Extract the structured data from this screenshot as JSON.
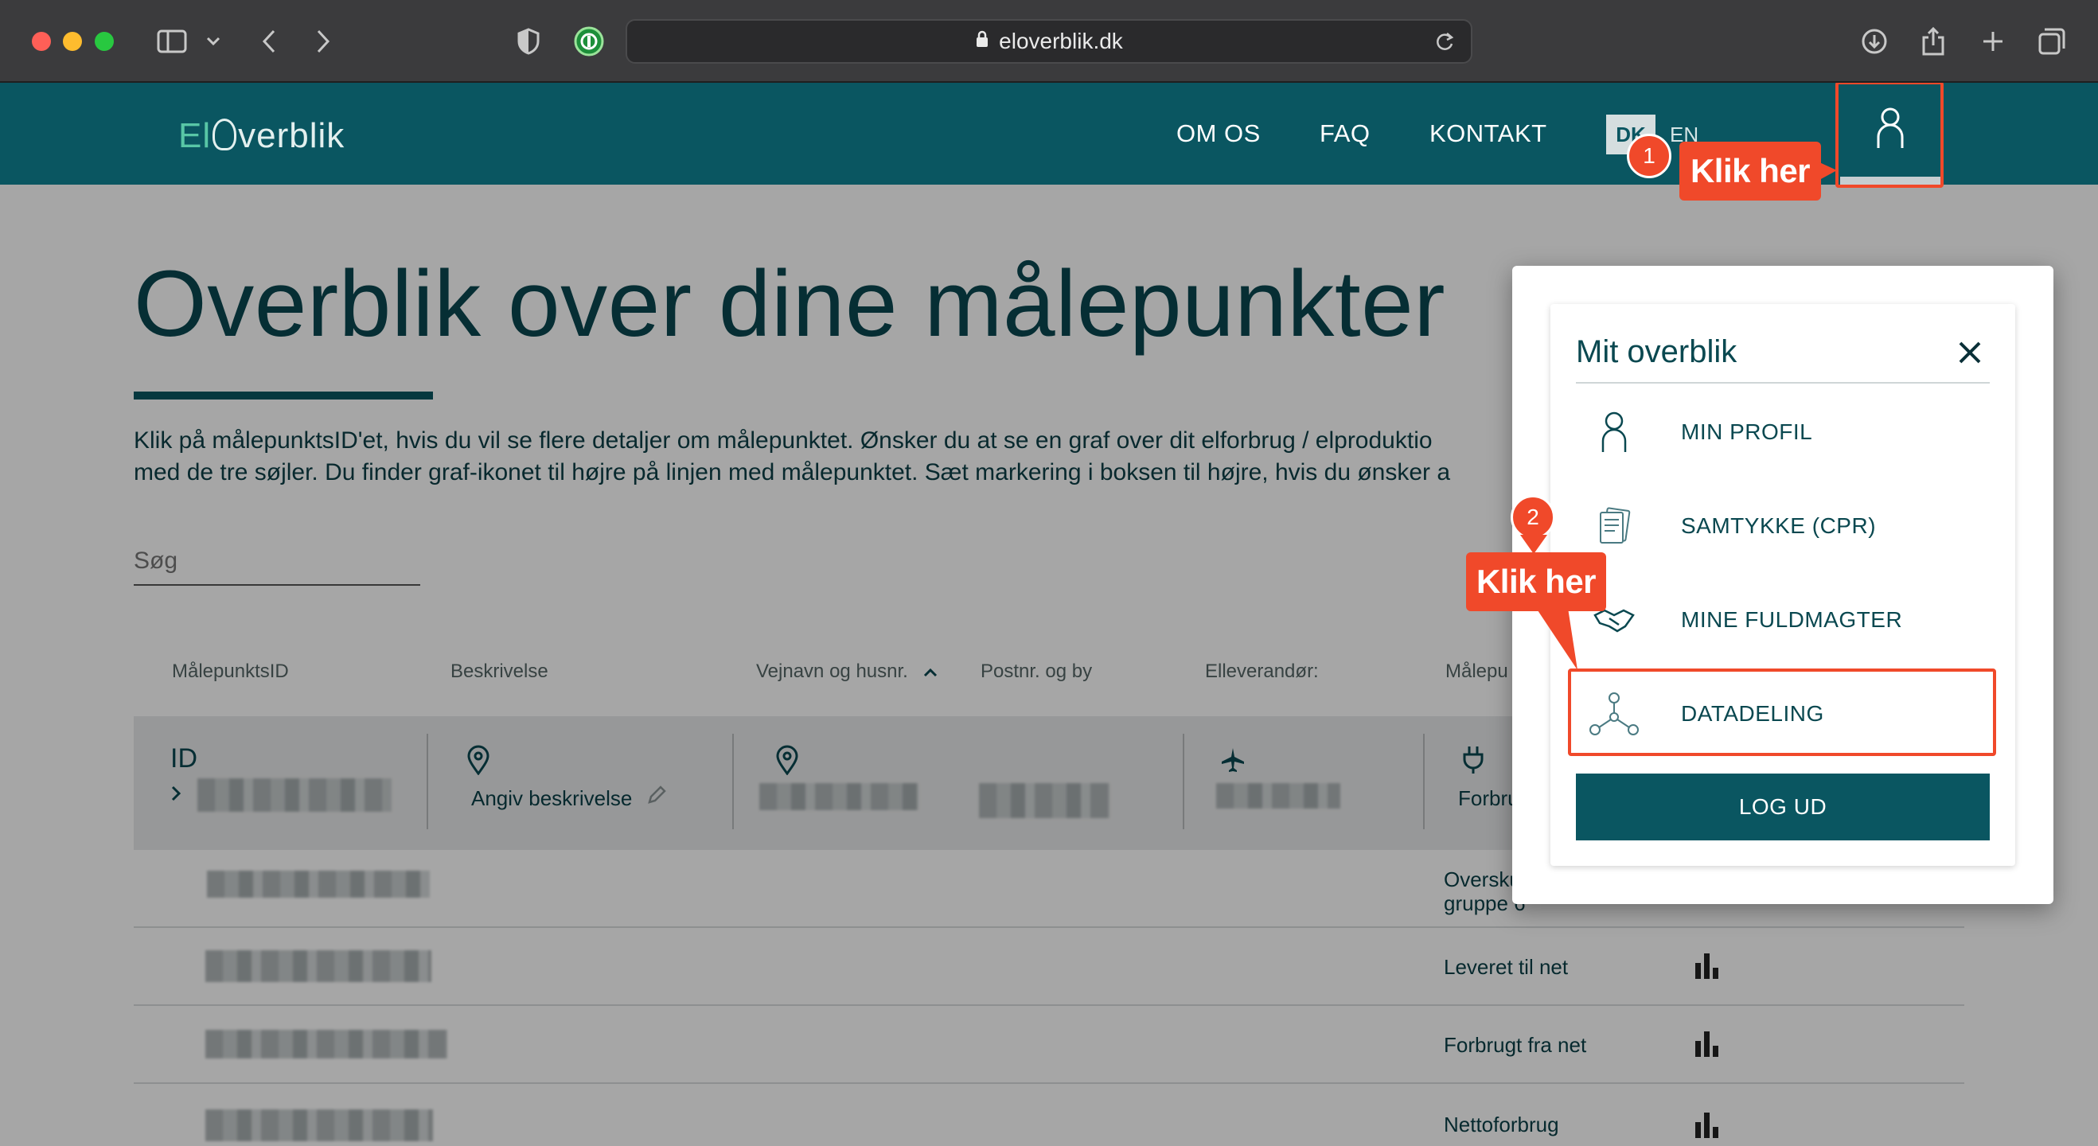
{
  "browser": {
    "url": "eloverblik.dk"
  },
  "header": {
    "logo_el": "El",
    "logo_rest": "verblik",
    "nav": [
      "OM OS",
      "FAQ",
      "KONTAKT"
    ],
    "lang_active": "DK",
    "lang_other": "EN"
  },
  "main": {
    "title": "Overblik over dine målepunkter",
    "intro_line1": "Klik på målepunktsID'et, hvis du vil se flere detaljer om målepunktet. Ønsker du at se en graf over dit elforbrug / elproduktio",
    "intro_line2": "med de tre søjler. Du finder graf-ikonet til højre på linjen med målepunktet. Sæt markering i boksen til højre, hvis du ønsker a",
    "search_placeholder": "Søg",
    "columns": [
      "MålepunktsID",
      "Beskrivelse",
      "Vejnavn og husnr.",
      "Postnr. og by",
      "Elleverandør:",
      "Målepu"
    ],
    "main_row": {
      "id_label": "ID",
      "description": "Angiv beskrivelse",
      "type_partial": "Forbru"
    },
    "rows": [
      {
        "label": "Oversku\ngruppe 6"
      },
      {
        "label": "Leveret til net"
      },
      {
        "label": "Forbrugt fra net"
      },
      {
        "label": "Nettoforbrug"
      }
    ]
  },
  "panel": {
    "title": "Mit overblik",
    "items": [
      {
        "label": "MIN PROFIL",
        "icon": "person-icon"
      },
      {
        "label": "SAMTYKKE (CPR)",
        "icon": "documents-icon"
      },
      {
        "label": "MINE FULDMAGTER",
        "icon": "handshake-icon"
      },
      {
        "label": "DATADELING",
        "icon": "network-icon"
      }
    ],
    "logout": "LOG UD"
  },
  "annotations": {
    "step1_number": "1",
    "step1_text": "Klik her",
    "step2_number": "2",
    "step2_text": "Klik her",
    "color": "#f0492a"
  },
  "colors": {
    "brand": "#0a5661",
    "text": "#0a4850"
  }
}
